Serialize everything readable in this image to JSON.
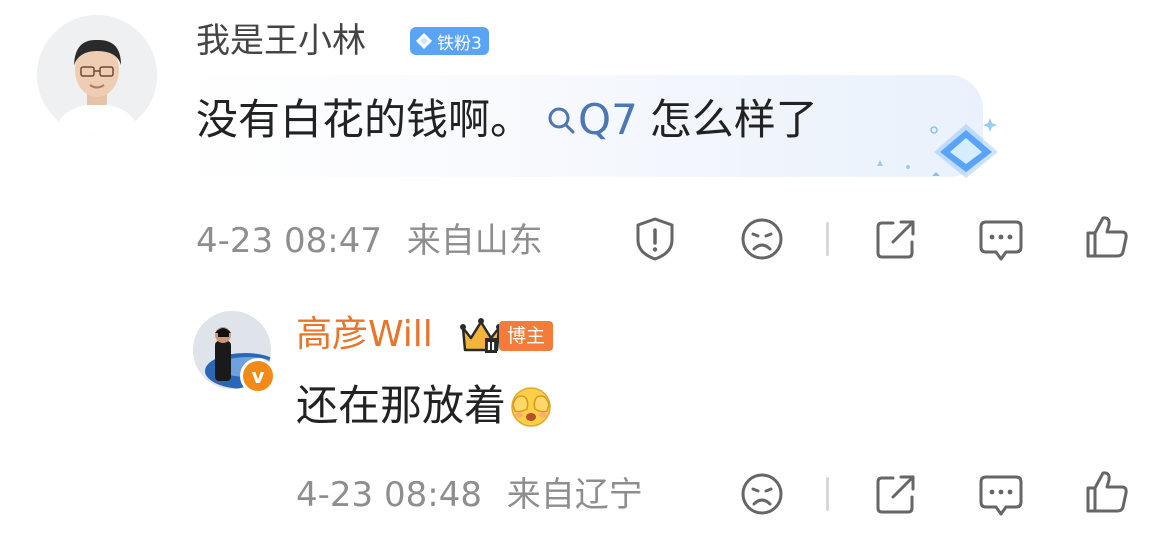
{
  "comment1": {
    "username": "我是王小林",
    "fan_badge": "铁粉3",
    "text_before": "没有白花的钱啊。",
    "search_link": "Q7",
    "text_after": "怎么样了",
    "time": "4-23 08:47",
    "location": "来自山东"
  },
  "comment2": {
    "username": "高彦Will",
    "host_badge": "博主",
    "text": "还在那放着",
    "emoji": "face-hiding-eyes-emoji",
    "time": "4-23 08:48",
    "location": "来自辽宁"
  },
  "icons": [
    "shield-warning-icon",
    "sad-face-icon",
    "share-icon",
    "comment-icon",
    "like-icon"
  ],
  "colors": {
    "username_gray": "#444444",
    "host_name_orange": "#e8752a",
    "fan_badge_blue": "#5aa4f7",
    "link_blue": "#4b77b5",
    "meta_gray": "#8e8e8e"
  }
}
